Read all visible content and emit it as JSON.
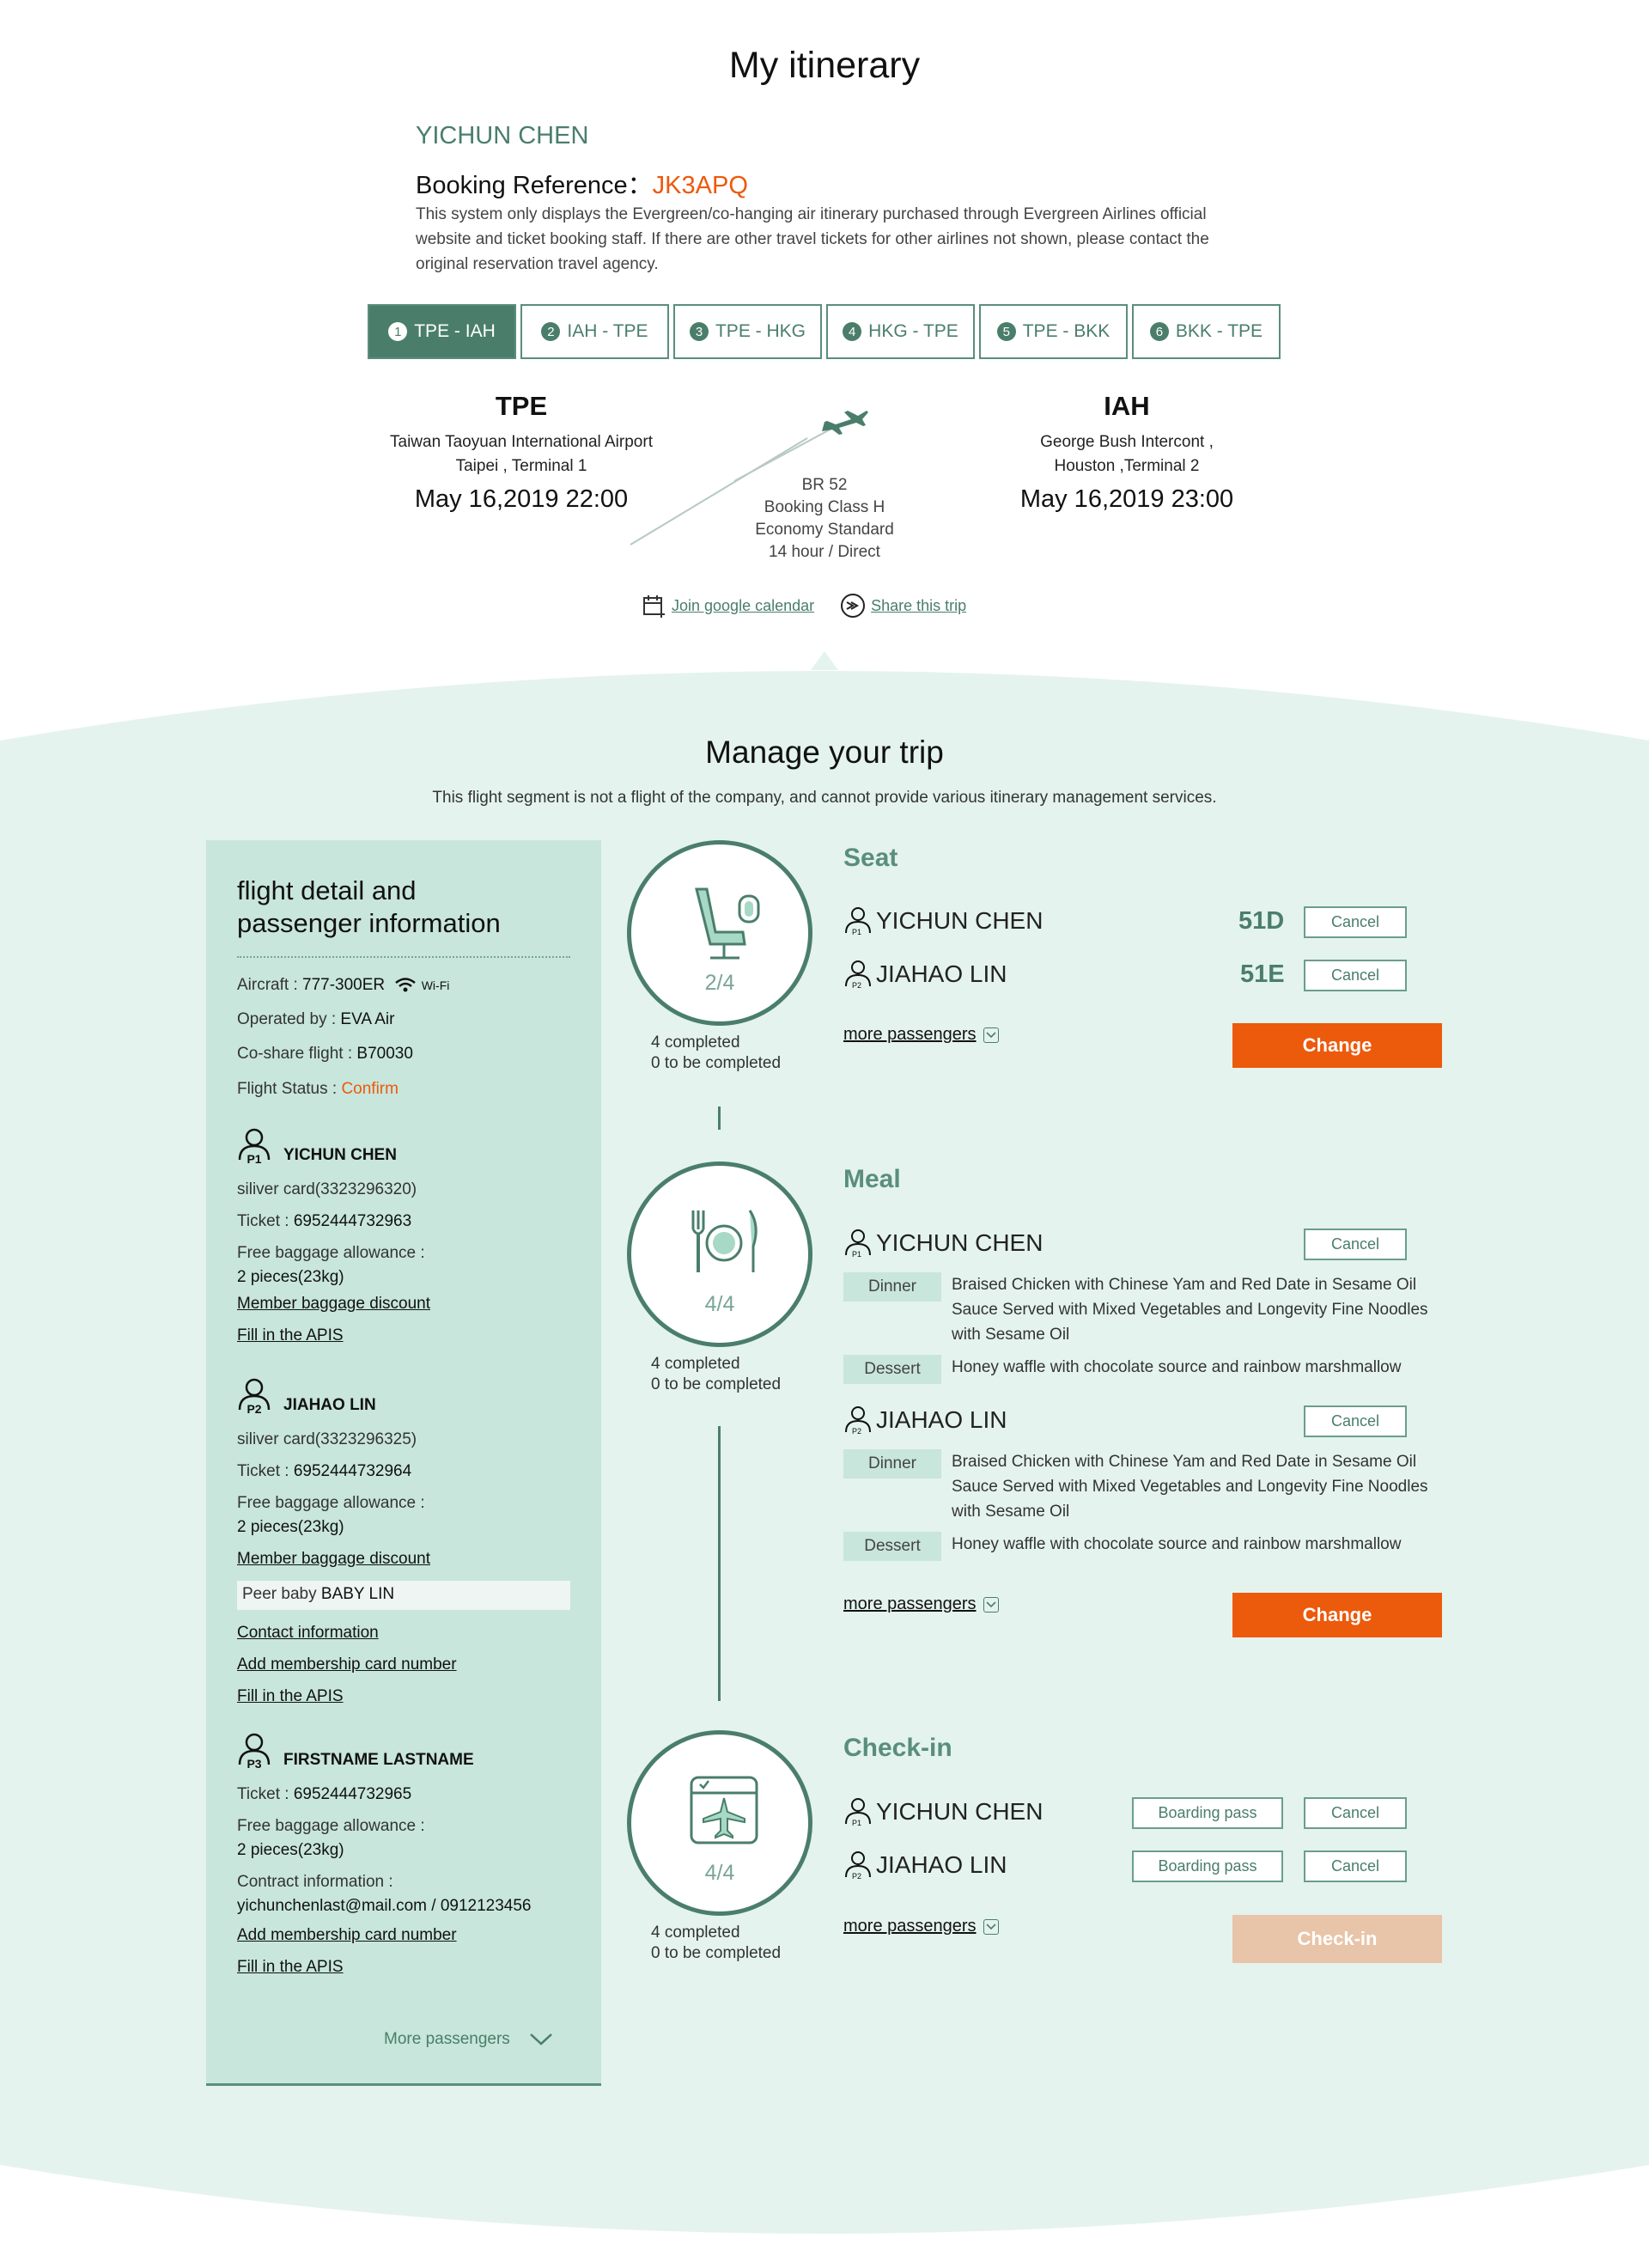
{
  "page": {
    "title": "My itinerary"
  },
  "booking": {
    "passenger_name": "YICHUN CHEN",
    "reference_label": "Booking Reference：",
    "reference_code": "JK3APQ",
    "note": "This system only displays the Evergreen/co-hanging air itinerary purchased through Evergreen Airlines official website and ticket booking staff. If there are other travel tickets for other airlines not shown, please contact the original reservation travel agency."
  },
  "tabs": [
    {
      "num": "1",
      "label": "TPE - IAH"
    },
    {
      "num": "2",
      "label": "IAH - TPE"
    },
    {
      "num": "3",
      "label": "TPE - HKG"
    },
    {
      "num": "4",
      "label": "HKG - TPE"
    },
    {
      "num": "5",
      "label": "TPE - BKK"
    },
    {
      "num": "6",
      "label": "BKK - TPE"
    }
  ],
  "flight": {
    "origin": {
      "code": "TPE",
      "name": "Taiwan Taoyuan International Airport",
      "city": "Taipei , Terminal 1",
      "time": "May 16,2019 22:00"
    },
    "destination": {
      "code": "IAH",
      "name": "George Bush Intercont ,",
      "city": "Houston ,Terminal 2",
      "time": "May 16,2019 23:00"
    },
    "number": "BR 52",
    "booking_class": "Booking Class H",
    "cabin": "Economy Standard",
    "duration": "14 hour / Direct",
    "calendar_link": "Join google calendar",
    "share_link": "Share this trip"
  },
  "manage": {
    "title": "Manage your trip",
    "note": "This flight segment is not a flight of the company, and cannot provide various itinerary management services."
  },
  "detail": {
    "heading_line1": "flight detail  and",
    "heading_line2": "passenger information",
    "aircraft_label": "Aircraft  : ",
    "aircraft": "777-300ER",
    "wifi": "Wi-Fi",
    "operated_label": "Operated by : ",
    "operated": "EVA Air",
    "codeshare_label": "Co-share flight : ",
    "codeshare": "B70030",
    "status_label": "Flight Status : ",
    "status": "Confirm",
    "passengers": [
      {
        "tag": "P1",
        "name": "YICHUN CHEN",
        "card": "siliver card(3323296320)",
        "ticket_label": "Ticket : ",
        "ticket": "6952444732963",
        "baggage_label": "Free baggage allowance :",
        "baggage": "2 pieces(23kg)",
        "discount": "Member baggage discount",
        "apis": "Fill in the APIS"
      },
      {
        "tag": "P2",
        "name": "JIAHAO LIN",
        "card": "siliver card(3323296325)",
        "ticket_label": "Ticket : ",
        "ticket": "6952444732964",
        "baggage_label": "Free baggage allowance :",
        "baggage": "2 pieces(23kg)",
        "discount": "Member baggage discount",
        "peer_label": "Peer baby ",
        "peer_name": "BABY LIN",
        "contact": "Contact information",
        "membership": "Add membership card number",
        "apis": "Fill in the APIS"
      },
      {
        "tag": "P3",
        "name": "FIRSTNAME LASTNAME",
        "ticket_label": "Ticket : ",
        "ticket": "6952444732965",
        "baggage_label": "Free baggage allowance :",
        "baggage": "2 pieces(23kg)",
        "contact_label": "Contract information :",
        "contact_value": "yichunchenlast@mail.com / 0912123456",
        "membership": "Add membership card number",
        "apis": "Fill in the APIS"
      }
    ],
    "more_passengers": "More passengers"
  },
  "seat": {
    "title": "Seat",
    "progress": "2/4",
    "completed": "4 completed",
    "pending": "0 to be completed",
    "rows": [
      {
        "tag": "P1",
        "name": "YICHUN CHEN",
        "seat": "51D",
        "cancel": "Cancel"
      },
      {
        "tag": "P2",
        "name": "JIAHAO LIN",
        "seat": "51E",
        "cancel": "Cancel"
      }
    ],
    "more": "more passengers",
    "action": "Change"
  },
  "meal": {
    "title": "Meal",
    "progress": "4/4",
    "completed": "4 completed",
    "pending": "0 to be completed",
    "rows": [
      {
        "tag": "P1",
        "name": "YICHUN CHEN",
        "cancel": "Cancel",
        "dinner_label": "Dinner",
        "dinner": "Braised Chicken with Chinese Yam and Red Date in  Sesame Oil Sauce Served with Mixed Vegetables and Longevity Fine Noodles with Sesame Oil",
        "dessert_label": "Dessert",
        "dessert": "Honey waffle with chocolate source and rainbow marshmallow"
      },
      {
        "tag": "P2",
        "name": "JIAHAO LIN",
        "cancel": "Cancel",
        "dinner_label": "Dinner",
        "dinner": "Braised Chicken with Chinese Yam and Red Date in  Sesame Oil Sauce Served with Mixed Vegetables and Longevity Fine Noodles with Sesame Oil",
        "dessert_label": "Dessert",
        "dessert": "Honey waffle with chocolate source and rainbow marshmallow"
      }
    ],
    "more": "more passengers",
    "action": "Change"
  },
  "checkin": {
    "title": "Check-in",
    "progress": "4/4",
    "completed": "4 completed",
    "pending": "0 to be completed",
    "rows": [
      {
        "tag": "P1",
        "name": "YICHUN CHEN",
        "boarding": "Boarding pass",
        "cancel": "Cancel"
      },
      {
        "tag": "P2",
        "name": "JIAHAO LIN",
        "boarding": "Boarding pass",
        "cancel": "Cancel"
      }
    ],
    "more": "more passengers",
    "action": "Check-in"
  },
  "colors": {
    "brand_green": "#4a7e6b",
    "panel_green": "#c8e6db",
    "bg_mint": "#e4f3ee",
    "accent_orange": "#ec5a0c",
    "disabled_orange": "#e8c4a8"
  }
}
